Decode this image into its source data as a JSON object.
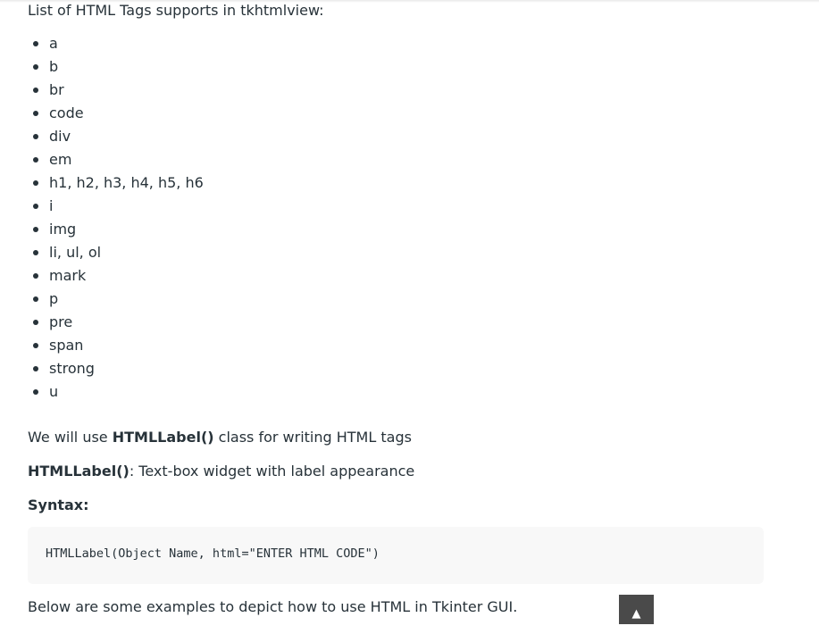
{
  "intro": "List of HTML Tags supports in tkhtmlview:",
  "tags": [
    "a",
    "b",
    "br",
    "code",
    "div",
    "em",
    "h1, h2, h3, h4, h5, h6",
    "i",
    "img",
    "li, ul, ol",
    "mark",
    "p",
    "pre",
    "span",
    "strong",
    "u"
  ],
  "usage": {
    "prefix": "We will use ",
    "class_name": "HTMLLabel()",
    "suffix": " class for writing HTML tags"
  },
  "definition": {
    "term": "HTMLLabel()",
    "text": ": Text-box widget with label appearance"
  },
  "syntax_heading": "Syntax:",
  "syntax_code": "HTMLLabel(Object Name, html=\"ENTER HTML CODE\")",
  "examples_text": "Below are some examples to depict how to use HTML in Tkinter GUI.",
  "scroll_top_glyph": "▲",
  "colors": {
    "text": "#273239",
    "code_background": "#f8f8f8",
    "scroll_button": "#4a4a4a"
  }
}
